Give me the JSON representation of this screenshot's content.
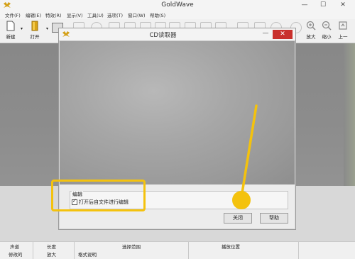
{
  "app": {
    "title": "GoldWave",
    "window_controls": {
      "minimize": "—",
      "maximize": "☐",
      "close": "✕"
    }
  },
  "menu": [
    "文件(F)",
    "编辑(E)",
    "特效(R)",
    "显示(V)",
    "工具(U)",
    "选项(T)",
    "窗口(W)",
    "帮助(S)"
  ],
  "toolbar": {
    "new_label": "新建",
    "open_label": "打开",
    "zoom_in_label": "放大",
    "zoom_out_label": "缩小",
    "previous_label": "上一",
    "icons": {
      "new": "new-file-icon",
      "open": "open-file-icon",
      "zoom_in": "zoom-in-icon",
      "zoom_out": "zoom-out-icon",
      "previous": "previous-icon"
    }
  },
  "dialog": {
    "title": "CD读取器",
    "minimize": "—",
    "close": "✕",
    "edit_group": {
      "legend": "编辑",
      "checkbox_label": "打开后自文件进行编辑",
      "checked": true
    },
    "close_button": "关闭",
    "help_button": "帮助"
  },
  "status": {
    "channel_label": "声道",
    "length_label": "长度",
    "selection_label": "选择范围",
    "playback_label": "播放位置",
    "row2_left": "修改的",
    "row2_zoom": "放大",
    "row2_format": "格式说明"
  },
  "colors": {
    "highlight": "#f4c20d",
    "dialog_close": "#c9302c"
  }
}
